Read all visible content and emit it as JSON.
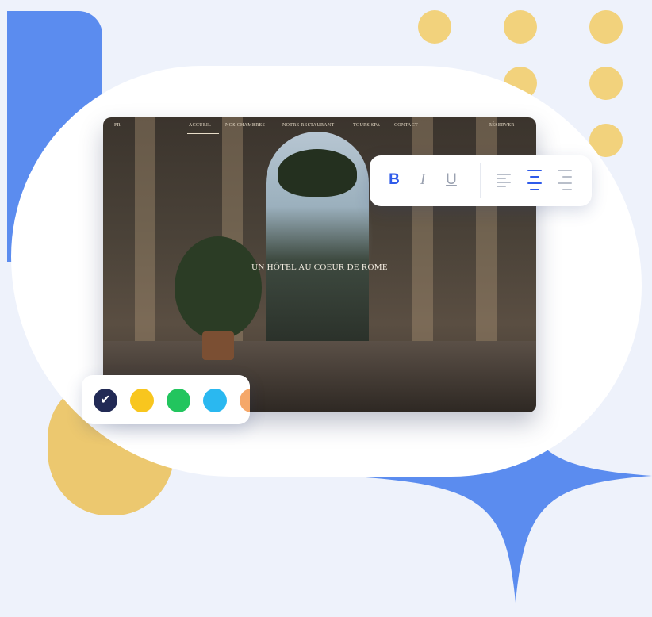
{
  "colors": {
    "background": "#eef2fb",
    "accent_blue": "#5b8cef",
    "accent_yellow": "#f2d27c",
    "toolbar_active": "#2f5bea",
    "toolbar_inactive": "#9aa1b0"
  },
  "website_preview": {
    "nav": {
      "lang": "FR",
      "items": [
        "ACCUEIL",
        "NOS CHAMBRES",
        "NOTRE RESTAURANT",
        "TOURS SPA",
        "CONTACT"
      ],
      "cta": "RÉSERVER"
    },
    "hero_title": "UN HÔTEL AU COEUR DE ROME"
  },
  "text_toolbar": {
    "bold": "B",
    "italic": "I",
    "underline": "U",
    "icons": [
      "align-left-icon",
      "align-center-icon",
      "align-right-icon"
    ],
    "active_alignment": "center"
  },
  "color_palette": {
    "swatches": [
      "#222a55",
      "#f8c61e",
      "#22c55e",
      "#2ab8f0",
      "#f5a86a"
    ],
    "selected": "#222a55"
  }
}
